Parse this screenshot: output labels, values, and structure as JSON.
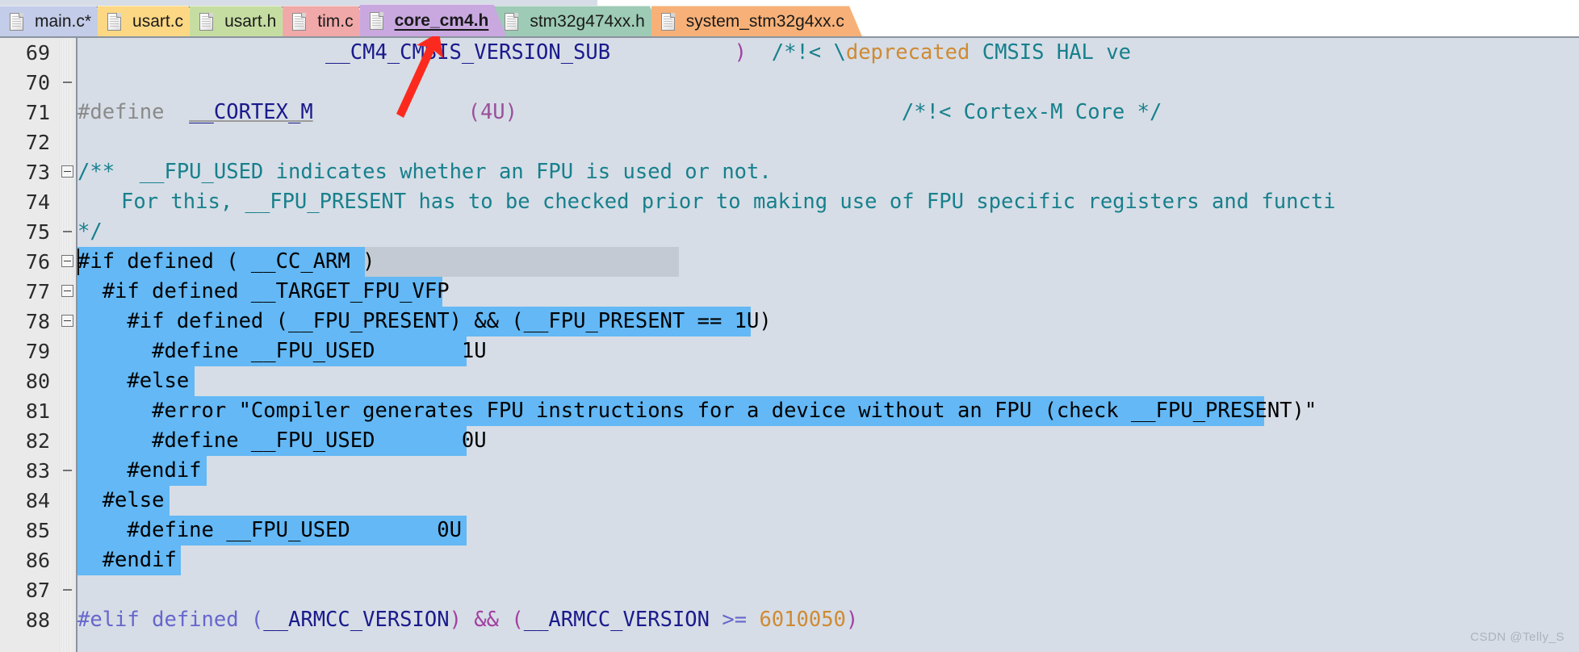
{
  "window": {
    "app_kind": "code-editor",
    "accent_selection_color": "#63b8f5",
    "editor_background_color": "#d6dde6",
    "gutter_background_color": "#eaeaea"
  },
  "tabs": [
    {
      "label": "main.c*",
      "color": "#c3cce8",
      "active": false,
      "icon": "file-icon"
    },
    {
      "label": "usart.c",
      "color": "#fcd884",
      "active": false,
      "icon": "file-icon"
    },
    {
      "label": "usart.h",
      "color": "#c6dda2",
      "active": false,
      "icon": "file-icon"
    },
    {
      "label": "tim.c",
      "color": "#f0a8a8",
      "active": false,
      "icon": "file-icon"
    },
    {
      "label": "core_cm4.h",
      "color": "#c9a8e0",
      "active": true,
      "icon": "file-icon"
    },
    {
      "label": "stm32g474xx.h",
      "color": "#9ecbb5",
      "active": false,
      "icon": "file-icon"
    },
    {
      "label": "system_stm32g4xx.c",
      "color": "#f7b178",
      "active": false,
      "icon": "file-icon"
    }
  ],
  "editor": {
    "first_visible_line": 69,
    "last_visible_line": 88,
    "caret_line": 76,
    "selection_start_line": 76,
    "selection_end_line": 86,
    "line_numbers": [
      "69",
      "70",
      "71",
      "72",
      "73",
      "74",
      "75",
      "76",
      "77",
      "78",
      "79",
      "80",
      "81",
      "82",
      "83",
      "84",
      "85",
      "86",
      "87",
      "88"
    ],
    "lines": {
      "l69_ident": "__CM4_CMSIS_VERSION_SUB",
      "l69_paren": ")",
      "l69_comment_a": "/*!< \\",
      "l69_comment_tag": "deprecated",
      "l69_comment_b": " CMSIS HAL ve",
      "l71_define": "#define",
      "l71_ident": "__CORTEX_M",
      "l71_value": "(4U)",
      "l71_comment": "/*!< Cortex-M Core */",
      "l73": "/**  __FPU_USED indicates whether an FPU is used or not.",
      "l74": "For this, __FPU_PRESENT has to be checked prior to making use of FPU specific registers and functi",
      "l75": "*/",
      "l76": "#if defined ( __CC_ARM )",
      "l77": "  #if defined __TARGET_FPU_VFP",
      "l78": "    #if defined (__FPU_PRESENT) && (__FPU_PRESENT == 1U)",
      "l79": "      #define __FPU_USED       1U",
      "l80": "    #else",
      "l81": "      #error \"Compiler generates FPU instructions for a device without an FPU (check __FPU_PRESENT)\"",
      "l82": "      #define __FPU_USED       0U",
      "l83": "    #endif",
      "l84": "  #else",
      "l85": "    #define __FPU_USED       0U",
      "l86": "  #endif",
      "l87": "",
      "l88_kw": "#elif defined (",
      "l88_id1": "__ARMCC_VERSION",
      "l88_op": ") && (",
      "l88_id2": "__ARMCC_VERSION",
      "l88_cmp": " >= ",
      "l88_num": "6010050",
      "l88_close": ")"
    }
  },
  "annotation": {
    "kind": "arrow",
    "color": "#fc2a1e",
    "points_to": "core_cm4.h tab"
  },
  "watermark": {
    "text": "CSDN @Telly_S"
  }
}
